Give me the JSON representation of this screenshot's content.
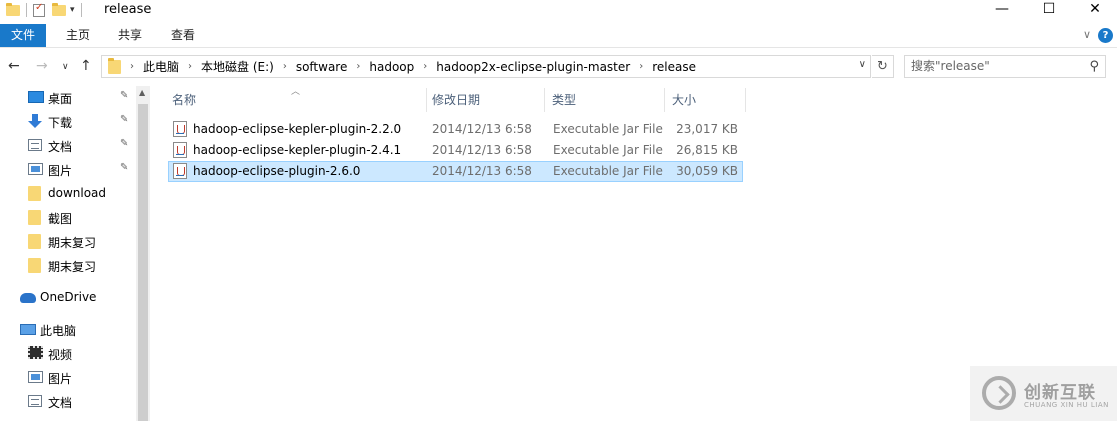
{
  "window": {
    "title": "release",
    "controls": {
      "minimize": "—",
      "maximize": "☐",
      "close": "✕"
    }
  },
  "ribbon": {
    "tabs": [
      "文件",
      "主页",
      "共享",
      "查看"
    ],
    "help": "?"
  },
  "address": {
    "breadcrumbs": [
      "此电脑",
      "本地磁盘 (E:)",
      "software",
      "hadoop",
      "hadoop2x-eclipse-plugin-master",
      "release"
    ]
  },
  "search": {
    "placeholder": "搜索\"release\""
  },
  "nav_pane": {
    "quick_access": [
      {
        "label": "桌面",
        "icon": "desktop-icon",
        "pinned": true
      },
      {
        "label": "下载",
        "icon": "download-arrow-icon",
        "pinned": true
      },
      {
        "label": "文档",
        "icon": "document-icon",
        "pinned": true
      },
      {
        "label": "图片",
        "icon": "picture-icon",
        "pinned": true
      },
      {
        "label": "download",
        "icon": "folder-icon",
        "pinned": false
      },
      {
        "label": "截图",
        "icon": "folder-icon",
        "pinned": false
      },
      {
        "label": "期末复习",
        "icon": "folder-icon",
        "pinned": false
      },
      {
        "label": "期末复习",
        "icon": "folder-icon",
        "pinned": false
      }
    ],
    "onedrive": "OneDrive",
    "this_pc": "此电脑",
    "pc_items": [
      {
        "label": "视频",
        "icon": "video-icon"
      },
      {
        "label": "图片",
        "icon": "picture-icon"
      },
      {
        "label": "文档",
        "icon": "document-icon"
      }
    ]
  },
  "file_list": {
    "columns": [
      "名称",
      "修改日期",
      "类型",
      "大小"
    ],
    "rows": [
      {
        "name": "hadoop-eclipse-kepler-plugin-2.2.0",
        "date": "2014/12/13 6:58",
        "type": "Executable Jar File",
        "size": "23,017 KB",
        "selected": false
      },
      {
        "name": "hadoop-eclipse-kepler-plugin-2.4.1",
        "date": "2014/12/13 6:58",
        "type": "Executable Jar File",
        "size": "26,815 KB",
        "selected": false
      },
      {
        "name": "hadoop-eclipse-plugin-2.6.0",
        "date": "2014/12/13 6:58",
        "type": "Executable Jar File",
        "size": "30,059 KB",
        "selected": true
      }
    ]
  },
  "watermark": {
    "text_cn": "创新互联",
    "text_en": "CHUANG XIN HU LIAN"
  },
  "colors": {
    "accent": "#1979ca",
    "selection": "#cce8ff",
    "selection_border": "#99d1ff"
  }
}
